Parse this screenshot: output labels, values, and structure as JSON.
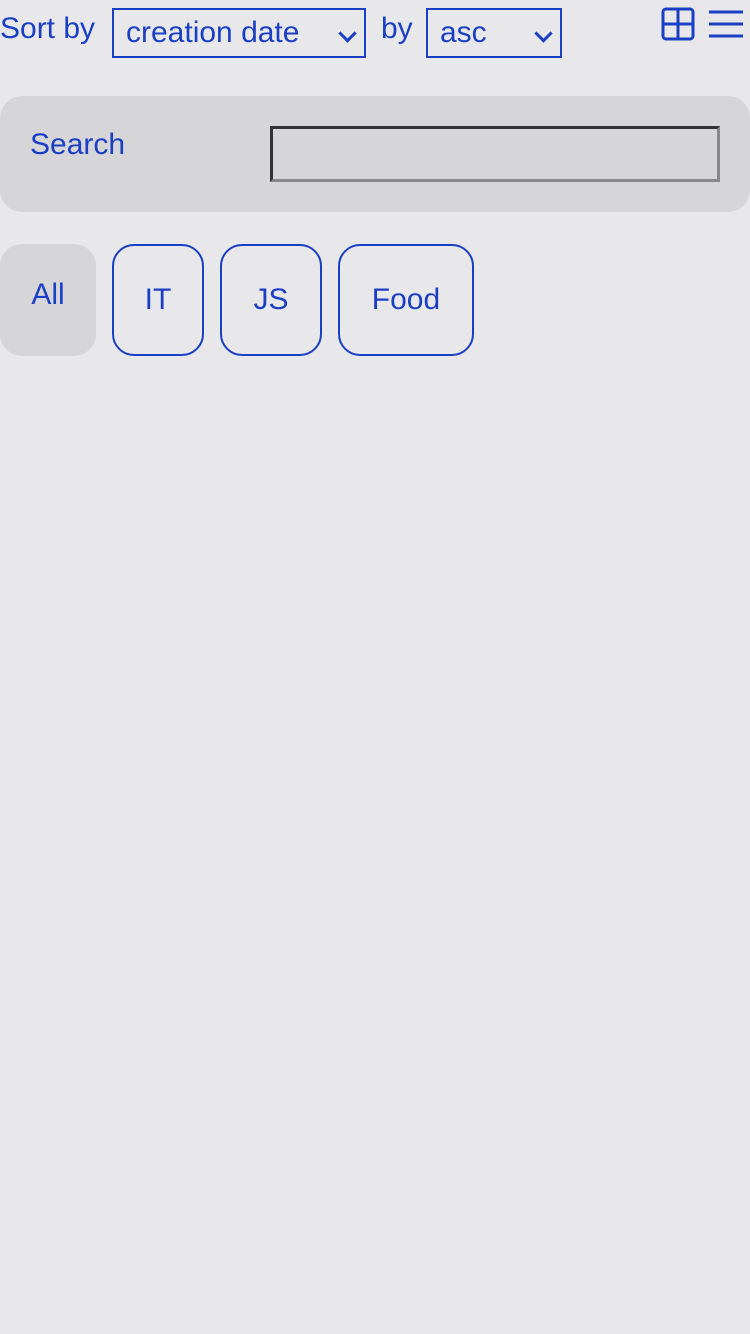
{
  "sort": {
    "label": "Sort by",
    "field_value": "creation date",
    "by_label": "by",
    "order_value": "asc"
  },
  "view": {
    "grid_icon": "grid-view-icon",
    "list_icon": "list-view-icon"
  },
  "search": {
    "label": "Search",
    "value": "",
    "placeholder": ""
  },
  "tags": [
    {
      "label": "All",
      "active": true
    },
    {
      "label": "IT",
      "active": false
    },
    {
      "label": "JS",
      "active": false
    },
    {
      "label": "Food",
      "active": false
    }
  ],
  "colors": {
    "accent": "#1b3fc4",
    "background": "#e8e8ea",
    "panel": "#d6d6d9"
  }
}
